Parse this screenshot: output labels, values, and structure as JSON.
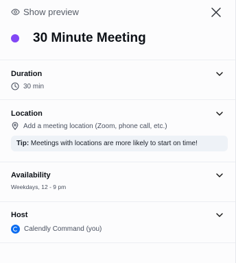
{
  "header": {
    "preview_label": "Show preview"
  },
  "event": {
    "title": "30 Minute Meeting",
    "color": "#8247f5"
  },
  "duration": {
    "label": "Duration",
    "value": "30 min"
  },
  "location": {
    "label": "Location",
    "placeholder": "Add a meeting location (Zoom, phone call, etc.)",
    "tip_prefix": "Tip:",
    "tip_text": " Meetings with locations are more likely to start on time!"
  },
  "availability": {
    "label": "Availability",
    "value": "Weekdays, 12 - 9 pm"
  },
  "host": {
    "label": "Host",
    "name": "Calendly Command (you)"
  },
  "icons": {
    "preview": "eye-icon",
    "close": "close-icon",
    "duration": "clock-icon",
    "location": "map-pin-icon",
    "expand": "chevron-down-icon",
    "host": "calendly-avatar"
  }
}
